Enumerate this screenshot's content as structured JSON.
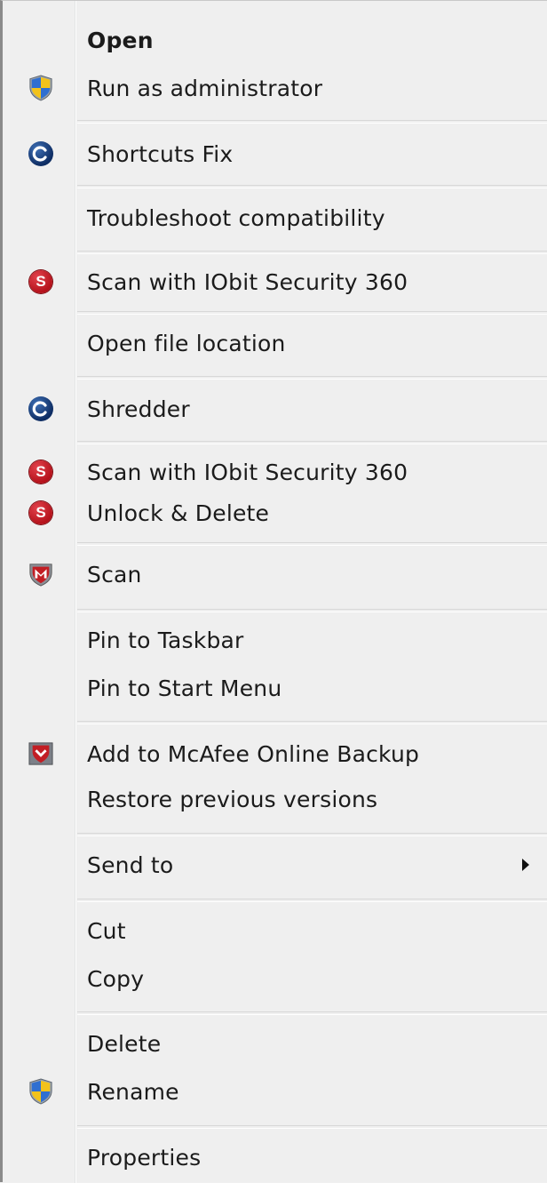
{
  "menu": {
    "items": [
      {
        "label": "Open",
        "icon": "",
        "bold": true
      },
      {
        "label": "Run as administrator",
        "icon": "uac-shield-icon"
      },
      {
        "label": "Shortcuts Fix",
        "icon": "advanced-systemcare-icon"
      },
      {
        "label": "Troubleshoot compatibility",
        "icon": ""
      },
      {
        "label": "Scan with IObit Security 360",
        "icon": "iobit-security-icon"
      },
      {
        "label": "Open file location",
        "icon": ""
      },
      {
        "label": "Shredder",
        "icon": "advanced-systemcare-icon"
      },
      {
        "label": "Scan with IObit Security 360",
        "icon": "iobit-security-icon"
      },
      {
        "label": "Unlock & Delete",
        "icon": "iobit-security-icon"
      },
      {
        "label": "Scan",
        "icon": "mcafee-shield-icon"
      },
      {
        "label": "Pin to Taskbar",
        "icon": ""
      },
      {
        "label": "Pin to Start Menu",
        "icon": ""
      },
      {
        "label": "Add to McAfee Online Backup",
        "icon": "mcafee-backup-icon"
      },
      {
        "label": "Restore previous versions",
        "icon": ""
      },
      {
        "label": "Send to",
        "icon": "",
        "submenu": true
      },
      {
        "label": "Cut",
        "icon": ""
      },
      {
        "label": "Copy",
        "icon": ""
      },
      {
        "label": "Delete",
        "icon": ""
      },
      {
        "label": "Rename",
        "icon": "uac-shield-icon"
      },
      {
        "label": "Properties",
        "icon": ""
      }
    ],
    "s_glyph": "S"
  },
  "colors": {
    "menu_bg": "#efefef",
    "iobit_red": "#c0141d",
    "asc_blue": "#123a7a",
    "mcafee_red": "#c21e24",
    "uac_blue": "#2f6fd1",
    "uac_yellow": "#f2c21b"
  }
}
